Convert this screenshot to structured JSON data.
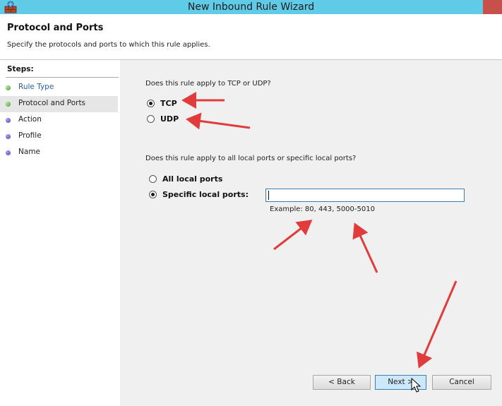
{
  "window": {
    "title": "New Inbound Rule Wizard"
  },
  "header": {
    "title": "Protocol and Ports",
    "subtitle": "Specify the protocols and ports to which this rule applies."
  },
  "steps": {
    "title": "Steps:",
    "items": [
      {
        "label": "Rule Type",
        "state": "done"
      },
      {
        "label": "Protocol and Ports",
        "state": "current"
      },
      {
        "label": "Action",
        "state": "pending"
      },
      {
        "label": "Profile",
        "state": "pending"
      },
      {
        "label": "Name",
        "state": "pending"
      }
    ]
  },
  "protocol": {
    "question": "Does this rule apply to TCP or UDP?",
    "options": [
      {
        "label": "TCP",
        "checked": true
      },
      {
        "label": "UDP",
        "checked": false
      }
    ]
  },
  "ports": {
    "question": "Does this rule apply to all local ports or specific local ports?",
    "options": [
      {
        "label": "All local ports",
        "checked": false
      },
      {
        "label": "Specific local ports:",
        "checked": true
      }
    ],
    "input_value": "",
    "example": "Example: 80, 443, 5000-5010"
  },
  "buttons": {
    "back": "< Back",
    "next": "Next >",
    "cancel": "Cancel"
  },
  "colors": {
    "titlebar": "#5fcbe6",
    "annotation_arrow": "#e23b3b",
    "close_button": "#c7504b"
  }
}
